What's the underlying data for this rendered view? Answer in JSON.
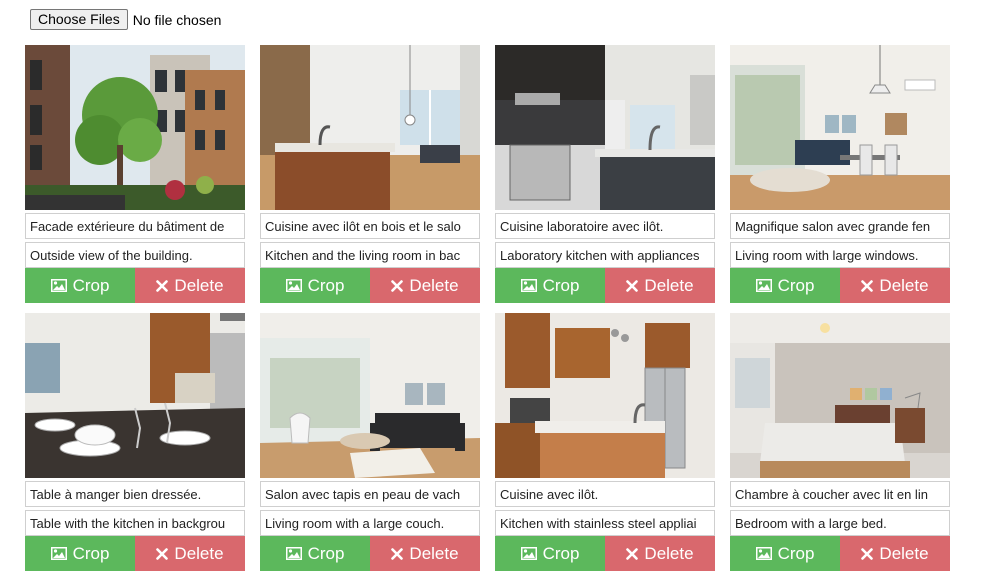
{
  "file_input": {
    "button_label": "Choose Files",
    "status": "No file chosen"
  },
  "actions": {
    "crop_label": "Crop",
    "delete_label": "Delete"
  },
  "colors": {
    "crop": "#5cb85c",
    "delete": "#d9686d"
  },
  "icons": {
    "crop": "image-icon",
    "delete": "x-icon"
  },
  "cards": [
    {
      "scene": "exterior",
      "caption_fr": "Facade extérieure du bâtiment de",
      "caption_en": "Outside view of the building."
    },
    {
      "scene": "kitchen-island",
      "caption_fr": "Cuisine avec ilôt en bois et le salo",
      "caption_en": "Kitchen and the living room in bac"
    },
    {
      "scene": "lab-kitchen",
      "caption_fr": "Cuisine laboratoire avec ilôt.",
      "caption_en": "Laboratory kitchen with appliances"
    },
    {
      "scene": "living-windows",
      "caption_fr": "Magnifique salon avec grande fen",
      "caption_en": "Living room with large windows."
    },
    {
      "scene": "dining-table",
      "caption_fr": "Table à manger bien dressée.",
      "caption_en": "Table with the kitchen in backgrou"
    },
    {
      "scene": "living-couch",
      "caption_fr": "Salon avec tapis en peau de vach",
      "caption_en": "Living room with a large couch."
    },
    {
      "scene": "kitchen-steel",
      "caption_fr": "Cuisine avec ilôt.",
      "caption_en": "Kitchen with stainless steel appliai"
    },
    {
      "scene": "bedroom",
      "caption_fr": "Chambre à coucher avec lit en lin",
      "caption_en": "Bedroom with a large bed."
    }
  ]
}
